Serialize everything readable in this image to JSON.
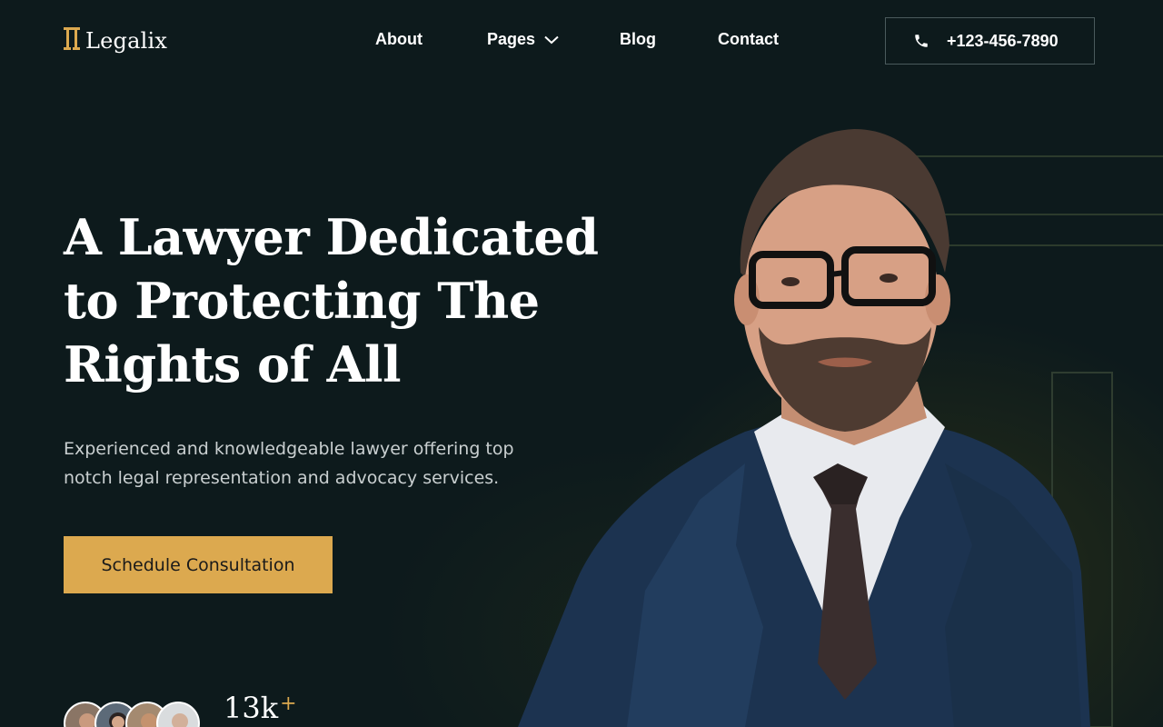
{
  "brand": {
    "name": "Legalix"
  },
  "nav": {
    "items": [
      {
        "label": "About"
      },
      {
        "label": "Pages"
      },
      {
        "label": "Blog"
      },
      {
        "label": "Contact"
      }
    ]
  },
  "header": {
    "phone": "+123-456-7890"
  },
  "hero": {
    "title_lines": [
      "A Lawyer Dedicated",
      "to Protecting The",
      "Rights of All"
    ],
    "subtitle": "Experienced and knowledgeable lawyer offering top notch legal representation and advocacy services.",
    "cta_label": "Schedule Consultation"
  },
  "stats": {
    "clients_value": "13k",
    "clients_suffix": "+"
  },
  "colors": {
    "background": "#0d1a1c",
    "accent": "#dca94f",
    "text": "#ffffff",
    "muted_text": "#c9cfd0"
  },
  "icons": {
    "logo": "pillar-icon",
    "pages_dropdown": "chevron-down-icon",
    "phone": "phone-icon"
  }
}
